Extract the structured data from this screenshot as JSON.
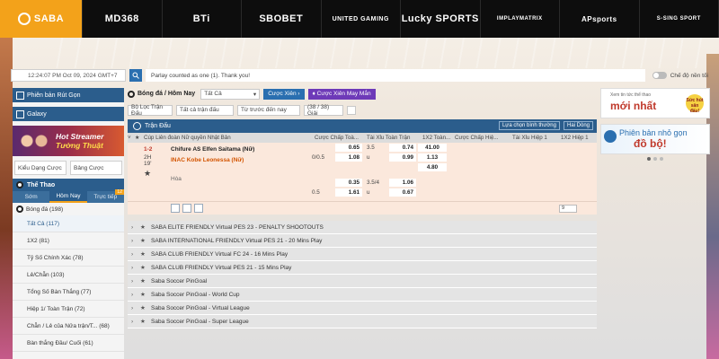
{
  "brands": [
    {
      "label": "SABA",
      "active": true
    },
    {
      "label": "MD368",
      "active": false
    },
    {
      "label": "BTi",
      "active": false
    },
    {
      "label": "SBOBET",
      "active": false
    },
    {
      "label": "UNITED GAMING",
      "active": false
    },
    {
      "label": "Lucky SPORTS",
      "active": false
    },
    {
      "label": "IMPLAYMATRIX",
      "active": false
    },
    {
      "label": "APsports",
      "active": false
    },
    {
      "label": "S-SING SPORT",
      "active": false
    }
  ],
  "status": {
    "clock": "12:24:07 PM Oct 09, 2024 GMT+7",
    "notice": "Parlay counted as one (1). Thank you!",
    "toggle_label": "Chế độ nền tối"
  },
  "sidebar": {
    "quick_version": "Phiên bản Rút Gọn",
    "galaxy": "Galaxy",
    "banner_line1": "Hot Streamer",
    "banner_line2": "Tường Thuật",
    "odds_select": "Kiểu Dạng Cược",
    "menu_select": "Bảng Cược",
    "section": "Thể Thao",
    "tabs": [
      {
        "label": "Sớm",
        "active": false
      },
      {
        "label": "Hôm Nay",
        "active": true
      },
      {
        "label": "Trực tiếp",
        "active": false,
        "badge": "12"
      }
    ],
    "sport": "Bóng đá  (198)",
    "items": [
      {
        "label": "Tất Cả  (117)",
        "active": true
      },
      {
        "label": "1X2  (81)",
        "active": false
      },
      {
        "label": "Tỷ Số Chính Xác  (78)",
        "active": false
      },
      {
        "label": "Lẻ/Chẵn  (103)",
        "active": false
      },
      {
        "label": "Tổng Số Bàn Thắng  (77)",
        "active": false
      },
      {
        "label": "Hiệp 1/ Toàn Trận  (72)",
        "active": false
      },
      {
        "label": "Chẵn / Lẻ của Nửa trận/T...  (68)",
        "active": false
      },
      {
        "label": "Bàn thắng Đầu/ Cuối  (61)",
        "active": false
      }
    ]
  },
  "toolbar": {
    "title": "Bóng đá / Hôm Nay",
    "filter_all": "Tất Cả",
    "parlay": "Cược Xiên",
    "lucky_parlay": "Cược Xiên May Mắn",
    "match_filter": "Bộ Lọc Trận Đấu",
    "all_matches": "Tất cả trận đấu",
    "from_earliest": "Từ trước đến nay",
    "league_count": "(38 / 38) Giải"
  },
  "league_bar": {
    "label": "Trận Đấu",
    "sort": "Lựa chọn bình thường",
    "view": "Hai Dòng"
  },
  "columns": [
    "Cúp Liên đoàn Nữ quyền Nhật Bản",
    "Cược Chấp Toà...",
    "Tài Xỉu Toàn Trận",
    "1X2 Toàn...",
    "Cược Chấp Hiệ...",
    "Tài Xỉu Hiệp 1",
    "1X2 Hiệp 1"
  ],
  "match": {
    "score": "1-2",
    "period": "2H",
    "minute": "19'",
    "home": "Chifure AS Elfen Saitama (Nữ)",
    "away": "INAC Kobe Leonessa (Nữ)",
    "draw": "Hòa",
    "block1": [
      [
        "",
        "0.65",
        "3.5",
        "0.74",
        "41.00"
      ],
      [
        "0/0.5",
        "1.08",
        "u",
        "0.99",
        "1.13"
      ],
      [
        "",
        "",
        "",
        "",
        "4.80"
      ]
    ],
    "block2": [
      [
        "",
        "0.35",
        "3.5/4",
        "1.06",
        ""
      ],
      [
        "0.5",
        "1.61",
        "u",
        "0.67",
        ""
      ]
    ],
    "page": "9"
  },
  "leagues": [
    "SABA ELITE FRIENDLY Virtual PES 23 - PENALTY SHOOTOUTS",
    "SABA INTERNATIONAL FRIENDLY Virtual PES 21 - 20 Mins Play",
    "SABA CLUB FRIENDLY Virtual FC 24 - 16 Mins Play",
    "SABA CLUB FRIENDLY Virtual PES 21 - 15 Mins Play",
    "Saba Soccer PinGoal",
    "Saba Soccer PinGoal - World Cup",
    "Saba Soccer PinGoal - Virtual League",
    "Saba Soccer PinGoal - Super League"
  ],
  "ads": {
    "ad1_small": "Xem tin tức thể thao",
    "ad1_big": "mới nhất",
    "ad1_badge": "Sức hút sân đấu!",
    "ad2_line1": "Phiên bản nhỏ gọn",
    "ad2_big": "đồ bộ!"
  },
  "colors": {
    "accent": "#f3a21a",
    "primary": "#2b5d8c",
    "parlay": "#2a6fb0",
    "lucky": "#6e3ab8",
    "match_bg": "#fbe8dc"
  }
}
